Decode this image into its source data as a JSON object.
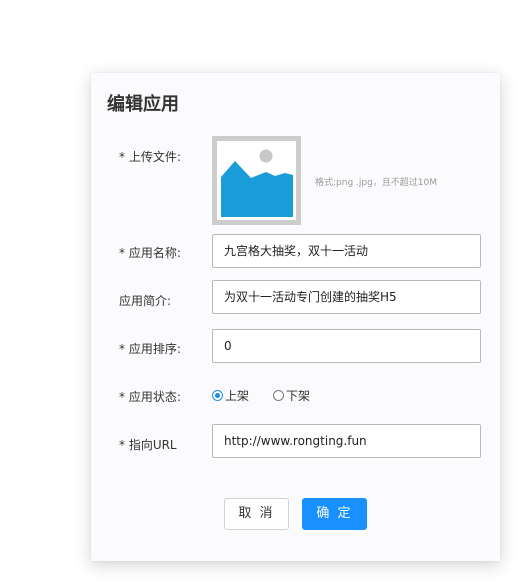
{
  "dialog": {
    "title": "编辑应用"
  },
  "form": {
    "upload_label": "* 上传文件:",
    "upload_hint": "格式:png .jpg，且不超过10M",
    "upload_icon": "image-placeholder-icon",
    "name_label": "* 应用名称:",
    "name_value": "九宫格大抽奖，双十一活动",
    "desc_label": "应用简介:",
    "desc_value": "为双十一活动专门创建的抽奖H5",
    "sort_label": "* 应用排序:",
    "sort_value": "0",
    "status_label": "* 应用状态:",
    "status_options": [
      {
        "label": "上架",
        "checked": true
      },
      {
        "label": "下架",
        "checked": false
      }
    ],
    "url_label": "* 指向URL",
    "url_value": "http://www.rongting.fun"
  },
  "buttons": {
    "cancel": "取 消",
    "ok": "确 定"
  },
  "colors": {
    "primary": "#1890ff",
    "image_sky": "#ffffff",
    "image_mountain": "#1a9cd8",
    "image_frame": "#cdcdcd"
  }
}
